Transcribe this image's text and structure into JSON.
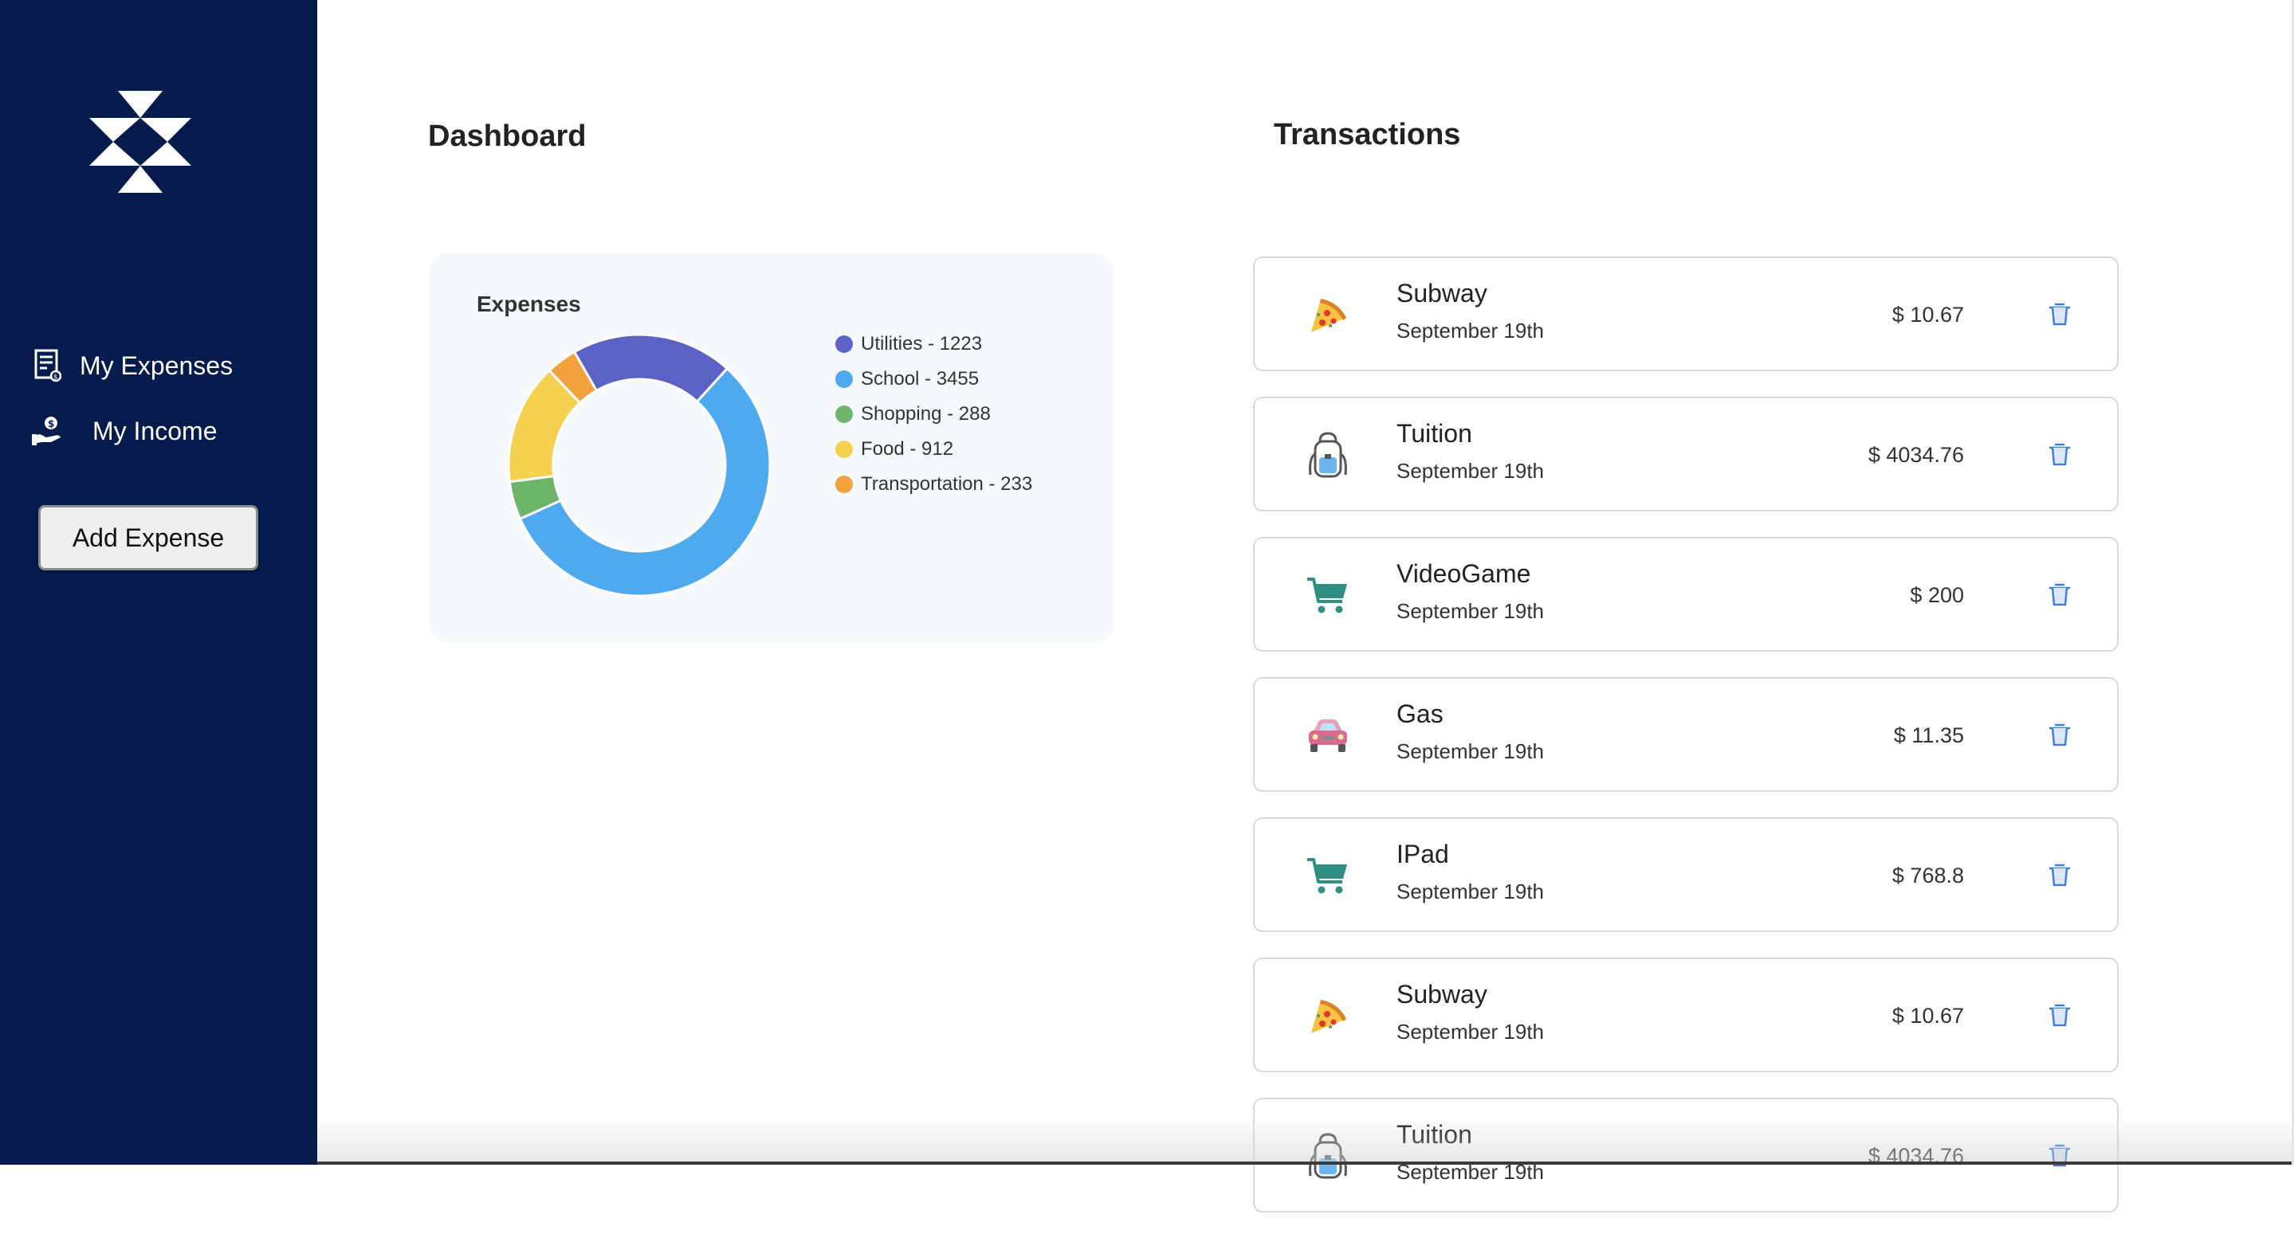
{
  "sidebar": {
    "logo_icon": "brand-logo",
    "nav": [
      {
        "label": "My Expenses",
        "icon": "expenses-receipt-icon"
      },
      {
        "label": "My Income",
        "icon": "income-hand-coin-icon"
      }
    ],
    "add_button": "Add Expense",
    "background": "#051b4c"
  },
  "dashboard": {
    "title": "Dashboard"
  },
  "chart_data": {
    "type": "pie",
    "variant": "donut",
    "title": "Expenses",
    "legend_position": "right",
    "slices": [
      {
        "label": "Utilities - 1223",
        "name": "Utilities",
        "value": 1223,
        "color": "#5c62c4"
      },
      {
        "label": "School - 3455",
        "name": "School",
        "value": 3455,
        "color": "#4ea9ef"
      },
      {
        "label": "Shopping - 288",
        "name": "Shopping",
        "value": 288,
        "color": "#6db56a"
      },
      {
        "label": "Food - 912",
        "name": "Food",
        "value": 912,
        "color": "#f4d151"
      },
      {
        "label": "Transportation - 233",
        "name": "Transportation",
        "value": 233,
        "color": "#f2a13f"
      }
    ]
  },
  "transactions": {
    "title": "Transactions",
    "items": [
      {
        "name": "Subway",
        "date": "September 19th",
        "amount": "$ 10.67",
        "icon": "pizza-icon"
      },
      {
        "name": "Tuition",
        "date": "September 19th",
        "amount": "$ 4034.76",
        "icon": "backpack-icon"
      },
      {
        "name": "VideoGame",
        "date": "September 19th",
        "amount": "$ 200",
        "icon": "shopping-cart-icon"
      },
      {
        "name": "Gas",
        "date": "September 19th",
        "amount": "$ 11.35",
        "icon": "car-icon"
      },
      {
        "name": "IPad",
        "date": "September 19th",
        "amount": "$ 768.8",
        "icon": "shopping-cart-icon"
      },
      {
        "name": "Subway",
        "date": "September 19th",
        "amount": "$ 10.67",
        "icon": "pizza-icon"
      },
      {
        "name": "Tuition",
        "date": "September 19th",
        "amount": "$ 4034.76",
        "icon": "backpack-icon"
      }
    ],
    "delete_icon": "trash-icon",
    "accent": "#3d7ee0"
  }
}
